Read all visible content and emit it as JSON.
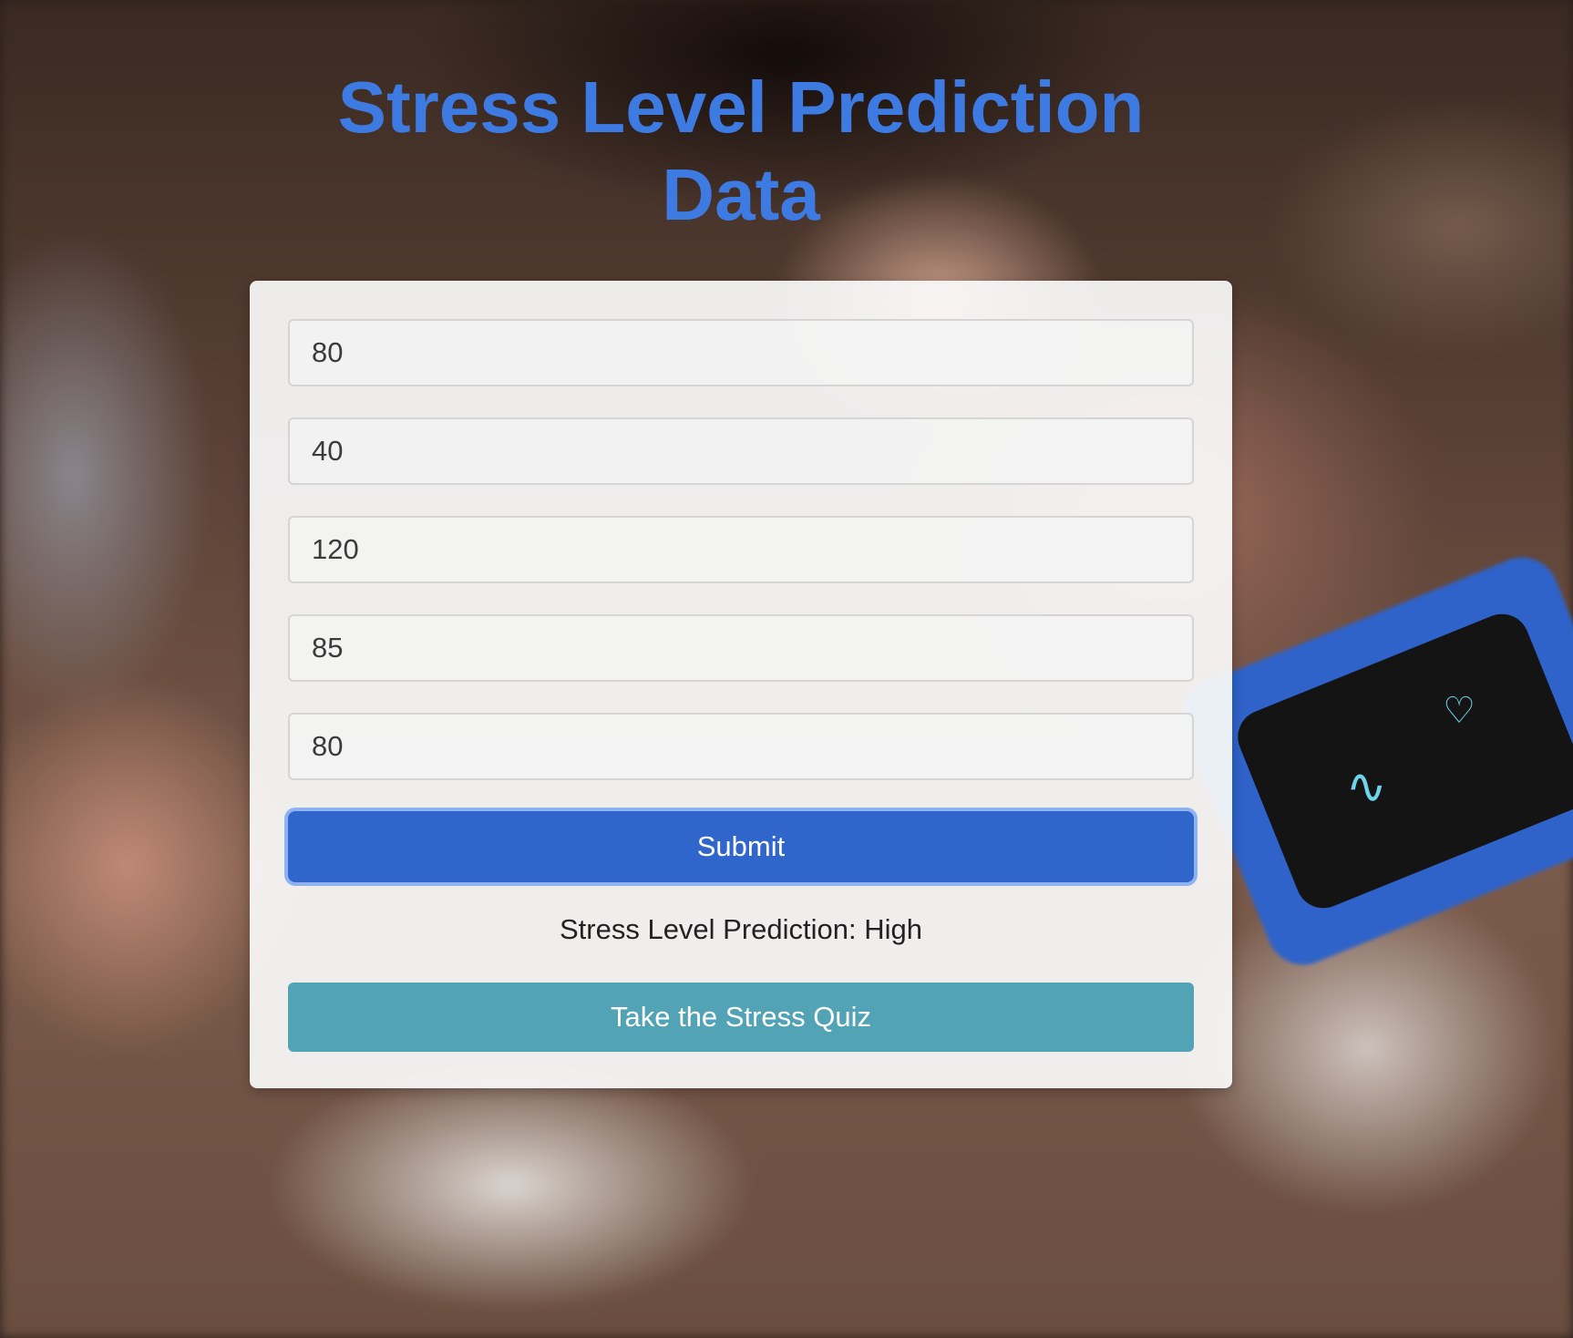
{
  "page": {
    "title_line1": "Stress Level Prediction",
    "title_line2": "Data"
  },
  "form": {
    "fields": [
      "80",
      "40",
      "120",
      "85",
      "80"
    ],
    "submit_label": "Submit",
    "result_text": "Stress Level Prediction: High",
    "quiz_label": "Take the Stress Quiz"
  },
  "background": {
    "device_icons": [
      "ecg-wave-icon",
      "heart-icon"
    ]
  },
  "colors": {
    "title": "#3d7be3",
    "submit": "#3066cc",
    "quiz": "#52a3b6"
  }
}
